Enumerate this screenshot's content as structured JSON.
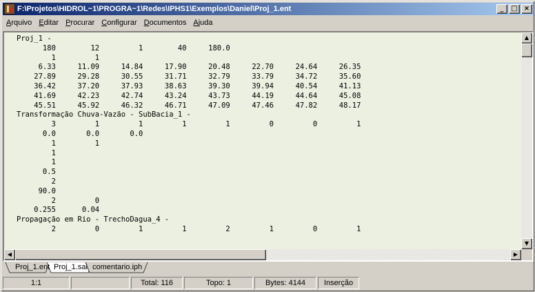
{
  "window": {
    "title": "F:\\Projetos\\HIDROL~1\\PROGRA~1\\Redes\\IPHS1\\Exemplos\\Daniel\\Proj_1.ent",
    "minimize_glyph": "_",
    "maximize_glyph": "□",
    "close_glyph": "×"
  },
  "menu": [
    {
      "label": "Arquivo",
      "accel": "A",
      "rest": "rquivo"
    },
    {
      "label": "Editar",
      "accel": "E",
      "rest": "ditar"
    },
    {
      "label": "Procurar",
      "accel": "P",
      "rest": "rocurar"
    },
    {
      "label": "Configurar",
      "accel": "C",
      "rest": "onfigurar"
    },
    {
      "label": "Documentos",
      "accel": "D",
      "rest": "ocumentos"
    },
    {
      "label": "Ajuda",
      "accel": "A",
      "rest": "juda"
    }
  ],
  "editor": {
    "lines": [
      "Proj_1 -",
      "      180        12         1        40     180.0",
      "        1         1",
      "     6.33     11.09     14.84     17.90     20.48     22.70     24.64     26.35",
      "    27.89     29.28     30.55     31.71     32.79     33.79     34.72     35.60",
      "    36.42     37.20     37.93     38.63     39.30     39.94     40.54     41.13",
      "    41.69     42.23     42.74     43.24     43.73     44.19     44.64     45.08",
      "    45.51     45.92     46.32     46.71     47.09     47.46     47.82     48.17",
      "Transformação Chuva-Vazão - SubBacia_1 -",
      "        3         1         1         1         1         0         0         1",
      "      0.0       0.0       0.0",
      "        1         1",
      "        1",
      "        1",
      "      0.5",
      "        2",
      "     90.0",
      "        2         0",
      "    0.255      0.04",
      "Propagação em Rio - TrechoDagua_4 -",
      "        2         0         1         1         2         1         0         1"
    ]
  },
  "scroll": {
    "up_glyph": "▲",
    "down_glyph": "▼",
    "left_glyph": "◀",
    "right_glyph": "▶"
  },
  "tabs": [
    {
      "label": "Proj_1.ent",
      "active": false
    },
    {
      "label": "Proj_1.sai",
      "active": true
    },
    {
      "label": "comentario.iph",
      "active": false
    }
  ],
  "status": {
    "position": "1:1",
    "blank": "",
    "total": "Total: 116",
    "topo": "Topo: 1",
    "bytes": "Bytes: 4144",
    "mode": "Inserção"
  }
}
